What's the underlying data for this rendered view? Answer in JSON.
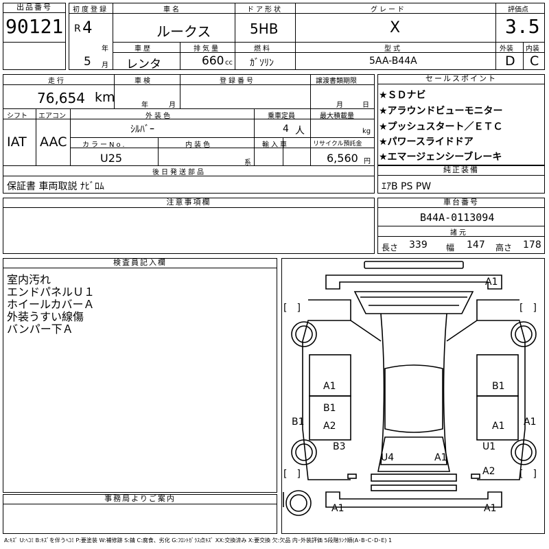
{
  "header": {
    "lot_label": "出品番号",
    "lot_value": "90121",
    "first_reg_label": "初度登録",
    "era": "R",
    "year": "4",
    "year_unit": "年",
    "month": "5",
    "month_unit": "月",
    "name_label": "車名",
    "name_value": "ルークス",
    "door_label": "ドア形状",
    "door_value": "5HB",
    "grade_label": "グレード",
    "grade_value": "X",
    "score_label": "評価点",
    "score_value": "3.5",
    "history_label": "車歴",
    "history_value": "レンタ",
    "displacement_label": "排気量",
    "displacement_value": "660",
    "displacement_unit": "cc",
    "fuel_label": "燃料",
    "fuel_value": "ｶﾞｿﾘﾝ",
    "model_label": "型式",
    "model_value": "5AA-B44A",
    "exterior_label": "外装",
    "exterior_value": "D",
    "interior_label": "内装",
    "interior_value": "C"
  },
  "mid": {
    "mileage_label": "走行",
    "mileage_value": "76,654",
    "mileage_unit": "km",
    "inspection_label": "車検",
    "inspection_year_unit": "年",
    "inspection_month_unit": "月",
    "regno_label": "登録番号",
    "transfer_label": "譲渡書類期限",
    "transfer_month_unit": "月",
    "transfer_day_unit": "日",
    "shift_label": "シフト",
    "shift_value": "IAT",
    "ac_label": "エアコン",
    "ac_value": "AAC",
    "color_label": "外装色",
    "color_value": "ｼﾙﾊﾞｰ",
    "capacity_label": "乗車定員",
    "capacity_value": "4",
    "capacity_unit": "人",
    "load_label": "最大積載量",
    "load_unit": "kg",
    "colorno_label": "カラーNo.",
    "colorno_value": "U25",
    "intcolor_label": "内装色",
    "intcolor_unit": "系",
    "import_label": "輸入車",
    "recycle_label": "リサイクル預託金",
    "recycle_value": "6,560",
    "recycle_unit": "円",
    "later_label": "後日発送部品",
    "later_value": "保証書 車両取説 ﾅﾋﾞﾛﾑ"
  },
  "sales": {
    "label": "セールスポイント",
    "items": [
      "★ＳＤナビ",
      "★アラウンドビューモニター",
      "★プッシュスタート／ＥＴＣ",
      "★パワースライドドア",
      "★エマージェンシーブレーキ"
    ]
  },
  "equipment": {
    "label": "純正装備",
    "value": "ｴｱB PS PW"
  },
  "notes": {
    "label": "注意事項欄"
  },
  "chassis": {
    "label": "車台番号",
    "value": "B44A-0113094",
    "dims_label": "諸元",
    "length_label": "長さ",
    "length_value": "339",
    "width_label": "幅",
    "width_value": "147",
    "height_label": "高さ",
    "height_value": "178"
  },
  "inspector": {
    "label": "検査員記入欄",
    "lines": [
      "室内汚れ",
      "エンドパネルＵ１",
      "ホイールカバーＡ",
      "外装うすい線傷",
      "バンパー下Ａ"
    ]
  },
  "office": {
    "label": "事務局よりご案内"
  },
  "diagram": {
    "marks": {
      "front_bumper": "A1",
      "left_front_door": "A1",
      "right_front_door": "B1",
      "left_pillar": "B1",
      "left_rear_door": "A2",
      "left_side": "B1",
      "right_rear_door": "A1",
      "right_side": "A1",
      "left_rear_fender": "B3",
      "right_rear_fender": "U1",
      "rear_left": "U4",
      "rear_right": "A1",
      "right_rear_quarter": "A2",
      "rear_bumper_left": "A1",
      "rear_bumper_right": "A1"
    },
    "bracket": "[　]"
  },
  "legend": "A:ｷｽﾞ U:ﾍｺﾐ B:ｷｽﾞを伴うﾍｺﾐ P:要塗装 W:補修跡 S:錆 C:腐食、劣化 G:ﾌﾛﾝﾄｶﾞﾗｽ点ｷｽﾞ XX:交換済み X:要交換 欠:欠品 内･外装評価 5段階ﾗﾝｸ順(A･B･C･D･E) 1"
}
